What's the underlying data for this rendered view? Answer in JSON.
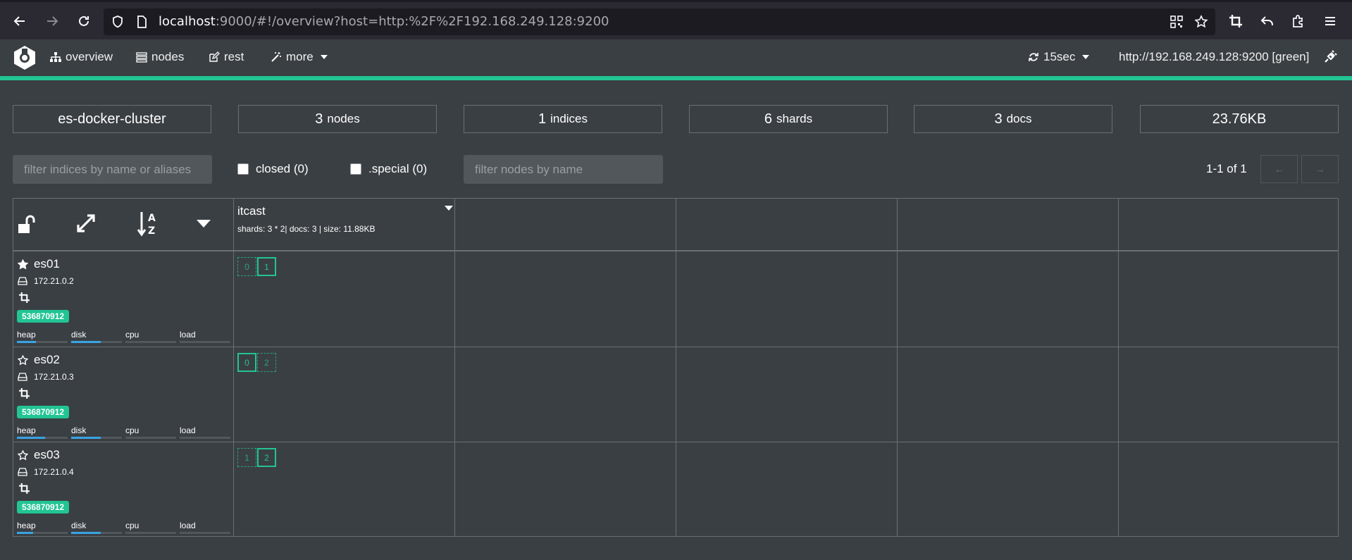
{
  "browser": {
    "url_host": "localhost",
    "url_rest": ":9000/#!/overview?host=http:%2F%2F192.168.249.128:9200"
  },
  "nav": {
    "overview": "overview",
    "nodes": "nodes",
    "rest": "rest",
    "more": "more",
    "refresh": "15sec",
    "cluster_url": "http://192.168.249.128:9200 [green]"
  },
  "stats": {
    "cluster_name": "es-docker-cluster",
    "nodes_num": "3",
    "nodes_label": "nodes",
    "indices_num": "1",
    "indices_label": "indices",
    "shards_num": "6",
    "shards_label": "shards",
    "docs_num": "3",
    "docs_label": "docs",
    "size": "23.76KB"
  },
  "filters": {
    "indices_placeholder": "filter indices by name or aliases",
    "closed_label": "closed (0)",
    "special_label": ".special (0)",
    "nodes_placeholder": "filter nodes by name",
    "pager": "1-1 of 1",
    "prev": "←",
    "next": "→"
  },
  "index": {
    "name": "itcast",
    "meta": "shards: 3 * 2| docs: 3 | size: 11.88KB"
  },
  "nodes": [
    {
      "name": "es01",
      "ip": "172.21.0.2",
      "badge": "536870912",
      "master": true,
      "heap": 0.38,
      "disk": 0.58,
      "cpu": 0,
      "load": 0,
      "shards": [
        {
          "label": "0",
          "primary": false
        },
        {
          "label": "1",
          "primary": true
        }
      ]
    },
    {
      "name": "es02",
      "ip": "172.21.0.3",
      "badge": "536870912",
      "master": false,
      "heap": 0.55,
      "disk": 0.58,
      "cpu": 0,
      "load": 0,
      "shards": [
        {
          "label": "0",
          "primary": true
        },
        {
          "label": "2",
          "primary": false
        }
      ]
    },
    {
      "name": "es03",
      "ip": "172.21.0.4",
      "badge": "536870912",
      "master": false,
      "heap": 0.32,
      "disk": 0.58,
      "cpu": 0,
      "load": 0,
      "shards": [
        {
          "label": "1",
          "primary": false
        },
        {
          "label": "2",
          "primary": true
        }
      ]
    }
  ],
  "metric_labels": {
    "heap": "heap",
    "disk": "disk",
    "cpu": "cpu",
    "load": "load"
  },
  "colors": {
    "accent": "#22c494",
    "bar_fill": "#3aa3e3",
    "background": "#3a3f44"
  }
}
